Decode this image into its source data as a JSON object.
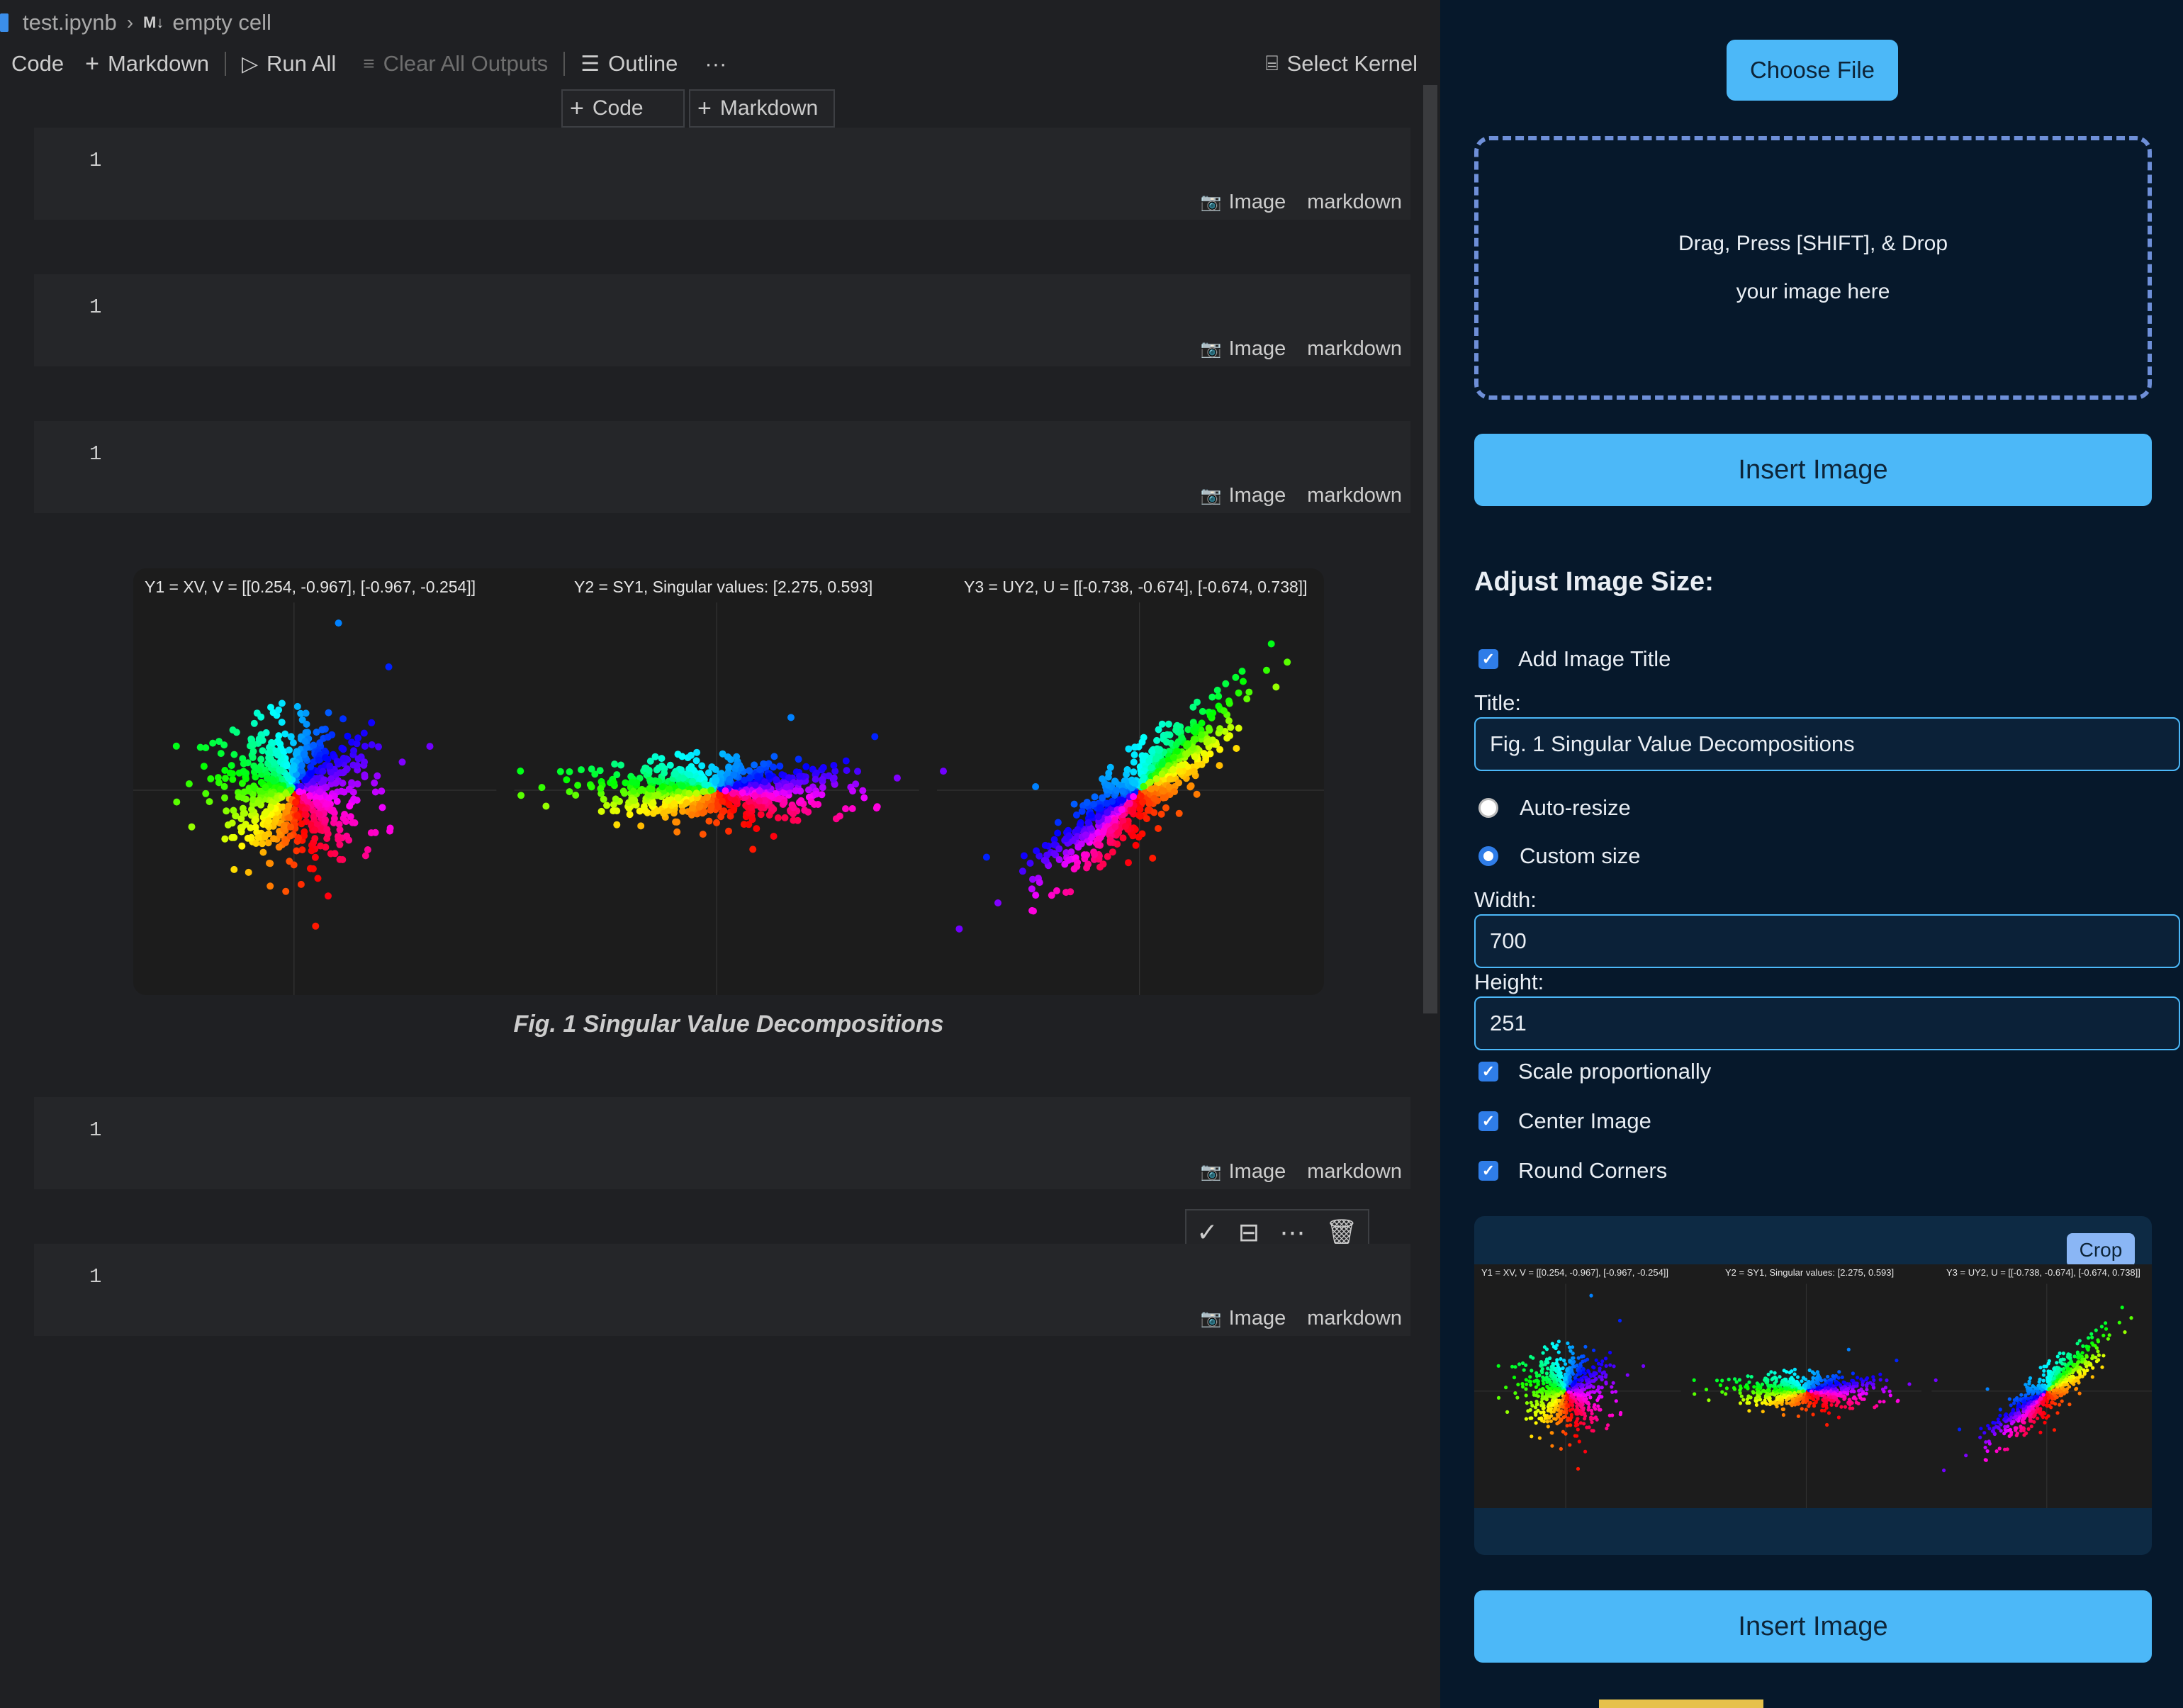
{
  "breadcrumb": {
    "file": "test.ipynb",
    "cell_type_badge": "M↓",
    "cell": "empty cell"
  },
  "toolbar": {
    "code_label": "Code",
    "markdown_label": "Markdown",
    "run_all_label": "Run All",
    "clear_outputs_label": "Clear All Outputs",
    "outline_label": "Outline",
    "more_label": "···",
    "select_kernel_label": "Select Kernel"
  },
  "insert_bar": {
    "code_label": "Code",
    "markdown_label": "Markdown"
  },
  "cells": [
    {
      "line": "1",
      "image_label": "Image",
      "lang": "markdown"
    },
    {
      "line": "1",
      "image_label": "Image",
      "lang": "markdown"
    },
    {
      "line": "1",
      "image_label": "Image",
      "lang": "markdown"
    },
    {
      "line": "1",
      "image_label": "Image",
      "lang": "markdown"
    },
    {
      "line": "1",
      "image_label": "Image",
      "lang": "markdown"
    }
  ],
  "figure": {
    "titles": [
      "Y1 = XV, V = [[0.254, -0.967], [-0.967, -0.254]]",
      "Y2 = SY1, Singular values: [2.275, 0.593]",
      "Y3 = UY2, U = [[-0.738, -0.674], [-0.674, 0.738]]"
    ],
    "caption": "Fig. 1 Singular Value Decompositions"
  },
  "panel": {
    "choose_file_label": "Choose File",
    "drop_line1": "Drag, Press [SHIFT], & Drop",
    "drop_line2": "your image here",
    "insert_image_label": "Insert Image",
    "heading": "Adjust Image Size:",
    "add_title_label": "Add Image Title",
    "add_title_checked": true,
    "title_label": "Title:",
    "title_value": "Fig. 1 Singular Value Decompositions",
    "auto_resize_label": "Auto-resize",
    "custom_size_label": "Custom size",
    "size_mode": "custom",
    "width_label": "Width:",
    "width_value": "700",
    "height_label": "Height:",
    "height_value": "251",
    "scale_label": "Scale proportionally",
    "center_label": "Center Image",
    "round_label": "Round Corners",
    "crop_label": "Crop"
  },
  "colors": {
    "accent": "#4cb8f8",
    "panel_bg": "#06182b",
    "editor_bg": "#1f2023",
    "dropzone_border": "#6e8fd8"
  }
}
